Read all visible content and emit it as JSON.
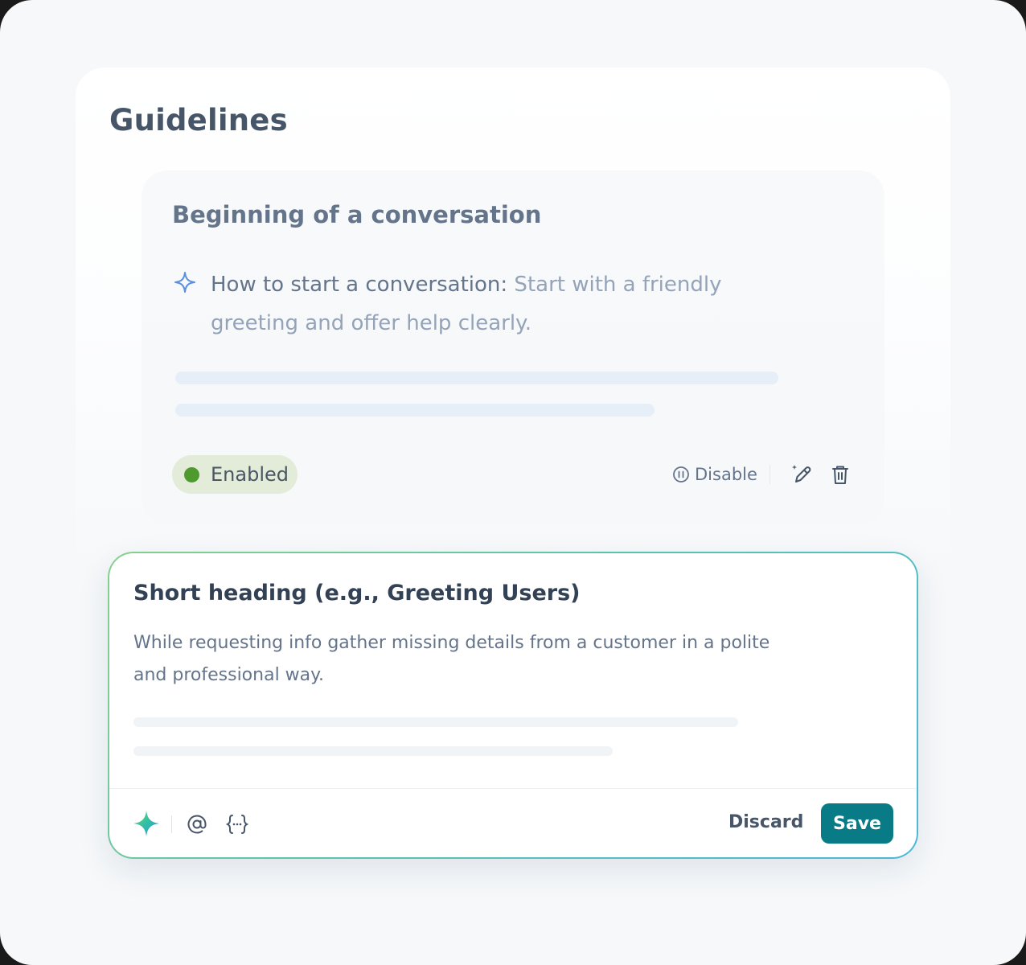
{
  "page": {
    "title": "Guidelines"
  },
  "guideline_card": {
    "title": "Beginning of a conversation",
    "item_label": "How to start a conversation:",
    "item_text": " Start with a friendly greeting and offer help clearly.",
    "status": "Enabled",
    "disable_label": "Disable"
  },
  "editor": {
    "title": "Short heading (e.g., Greeting Users)",
    "body": "While requesting info gather missing details from a customer in a polite and professional way.",
    "discard_label": "Discard",
    "save_label": "Save"
  },
  "colors": {
    "accent": "#087b86",
    "enabled_dot": "#4f9a2f",
    "enabled_bg": "#e2ecd9"
  },
  "icons": [
    "sparkle-outline-icon",
    "pause-circle-icon",
    "edit-pen-icon",
    "trash-icon",
    "ai-sparkle-icon",
    "at-sign-icon",
    "variable-braces-icon"
  ]
}
